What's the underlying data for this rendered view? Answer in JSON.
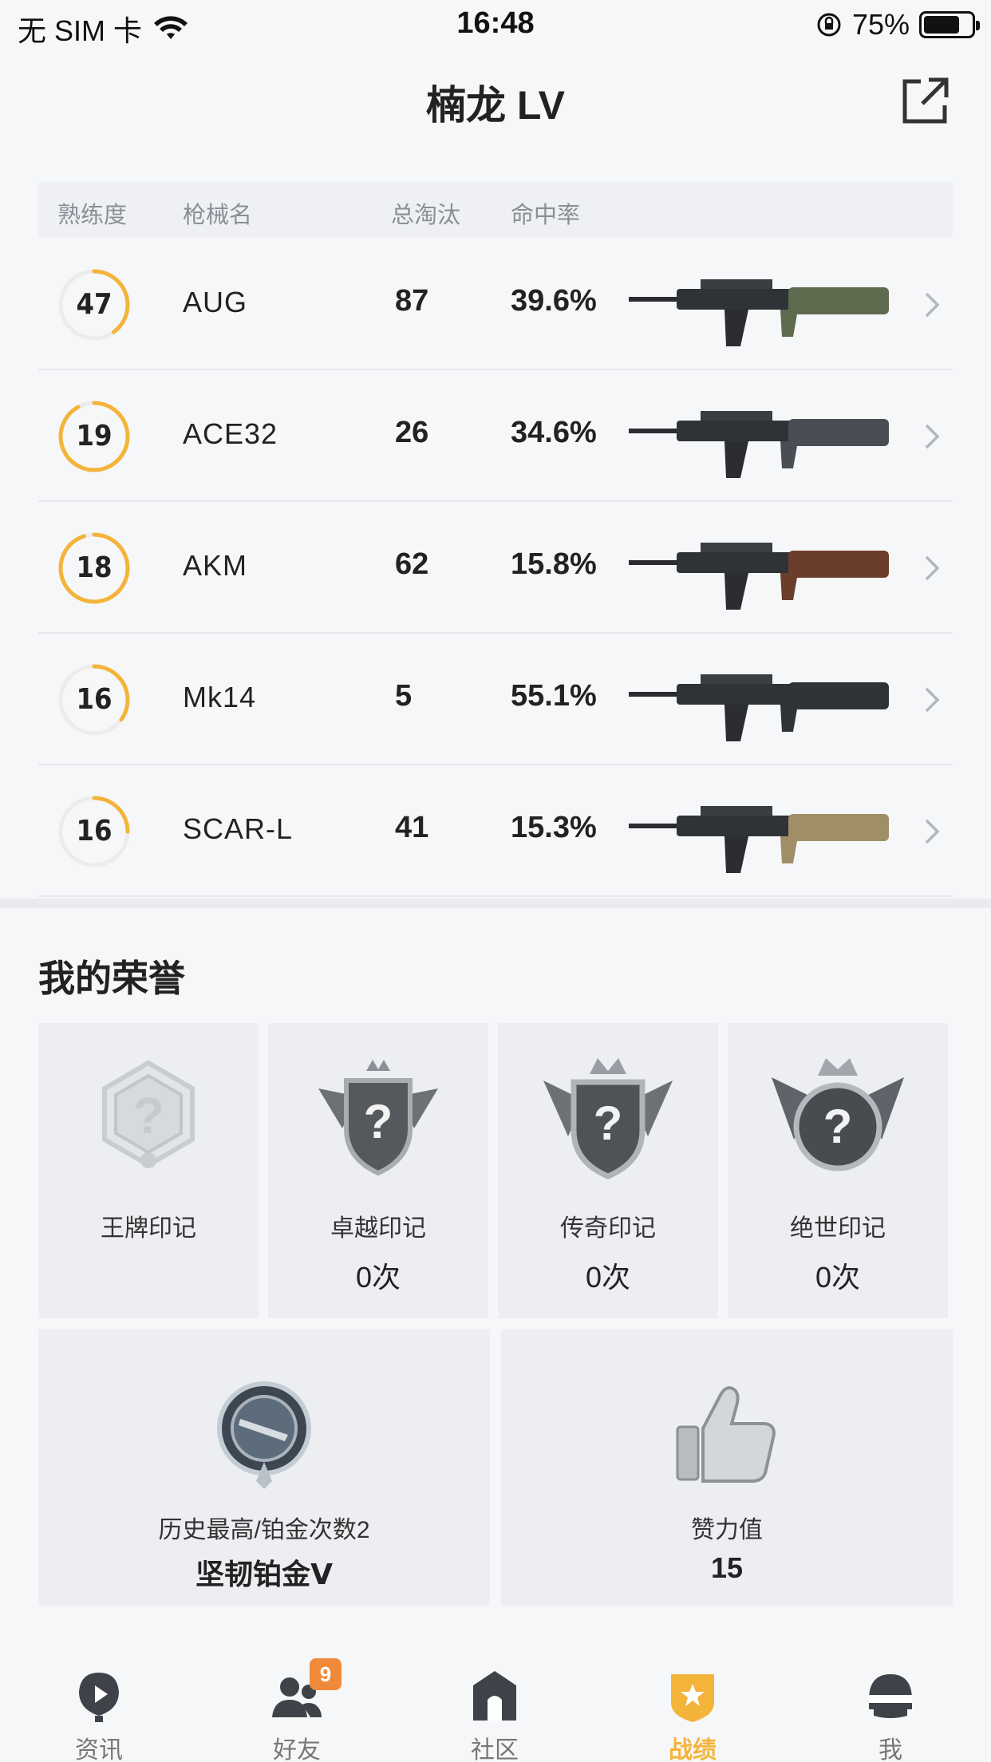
{
  "status_bar": {
    "carrier": "无 SIM 卡",
    "time": "16:48",
    "battery_percent": "75%",
    "battery_level": 0.75
  },
  "header": {
    "title": "楠龙 LV",
    "share_icon": "share-external-icon"
  },
  "weapon_table": {
    "headers": {
      "proficiency": "熟练度",
      "weapon_name": "枪械名",
      "total_kills": "总淘汰",
      "hit_rate": "命中率"
    },
    "rows": [
      {
        "level": "47",
        "level_progress": 0.4,
        "name": "AUG",
        "kills": "87",
        "hit_rate": "39.6%",
        "weapon_icon": "aug-rifle-image"
      },
      {
        "level": "19",
        "level_progress": 0.92,
        "name": "ACE32",
        "kills": "26",
        "hit_rate": "34.6%",
        "weapon_icon": "ace32-rifle-image"
      },
      {
        "level": "18",
        "level_progress": 0.95,
        "name": "AKM",
        "kills": "62",
        "hit_rate": "15.8%",
        "weapon_icon": "akm-rifle-image"
      },
      {
        "level": "16",
        "level_progress": 0.35,
        "name": "Mk14",
        "kills": "5",
        "hit_rate": "55.1%",
        "weapon_icon": "mk14-rifle-image"
      },
      {
        "level": "16",
        "level_progress": 0.25,
        "name": "SCAR-L",
        "kills": "41",
        "hit_rate": "15.3%",
        "weapon_icon": "scarl-rifle-image"
      }
    ]
  },
  "honors": {
    "title": "我的荣誉",
    "marks": [
      {
        "label": "王牌印记",
        "count": "",
        "icon": "ace-mark-icon"
      },
      {
        "label": "卓越印记",
        "count": "0次",
        "icon": "excellence-mark-icon"
      },
      {
        "label": "传奇印记",
        "count": "0次",
        "icon": "legend-mark-icon"
      },
      {
        "label": "绝世印记",
        "count": "0次",
        "icon": "peerless-mark-icon"
      }
    ],
    "rank": {
      "label": "历史最高/铂金次数2",
      "value": "坚韧铂金Ⅴ",
      "icon": "platinum-rank-icon"
    },
    "likes": {
      "label": "赞力值",
      "value": "15",
      "icon": "thumbs-up-icon"
    }
  },
  "tab_bar": {
    "tabs": [
      {
        "label": "资讯",
        "icon": "news-icon",
        "active": false
      },
      {
        "label": "好友",
        "icon": "friends-icon",
        "active": false,
        "badge": "9"
      },
      {
        "label": "社区",
        "icon": "community-icon",
        "active": false
      },
      {
        "label": "战绩",
        "icon": "record-icon",
        "active": true
      },
      {
        "label": "我",
        "icon": "helmet-icon",
        "active": false
      }
    ]
  },
  "colors": {
    "accent": "#f4b43a",
    "badge": "#f08a3a",
    "ring_track": "#ececec"
  }
}
